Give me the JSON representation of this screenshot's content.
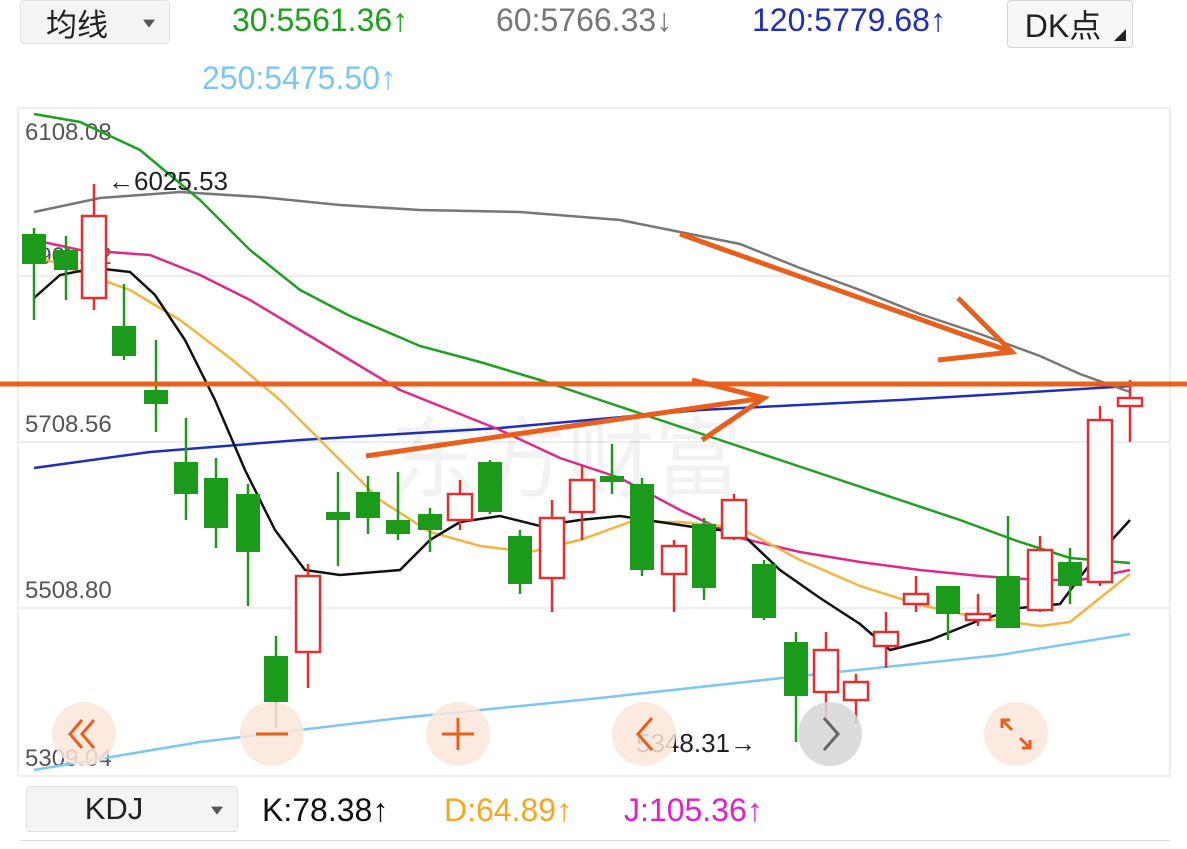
{
  "toolbar": {
    "indicator_select": "均线",
    "ma30": "30:5561.36",
    "ma60": "60:5766.33",
    "ma120": "120:5779.68",
    "ma250": "250:5475.50",
    "ma30_arrow": "↑",
    "ma60_arrow": "↓",
    "ma120_arrow": "↑",
    "ma250_arrow": "↑",
    "dk_button": "DK点"
  },
  "colors": {
    "ma5": "#111111",
    "ma10": "#f5b342",
    "ma20": "#e0288c",
    "ma30": "#1ea01e",
    "ma60": "#777777",
    "ma120": "#1f2fb8",
    "ma250": "#7cc7f2",
    "up": "#e03030",
    "down": "#1c9a1c",
    "annotation": "#e8601c"
  },
  "chart": {
    "y_labels": [
      "6108.08",
      "5908.32",
      "5708.56",
      "5508.80",
      "5309.04"
    ],
    "high_marker": "←6025.53",
    "low_marker": "5348.31→",
    "watermark": "东方财富"
  },
  "nav_icons": [
    "rewind-icon",
    "minus-icon",
    "plus-icon",
    "prev-icon",
    "next-icon",
    "expand-icon"
  ],
  "kdj": {
    "select": "KDJ",
    "k": "K:78.38",
    "d": "D:64.89",
    "j": "J:105.36",
    "k_arrow": "↑",
    "d_arrow": "↑",
    "j_arrow": "↑"
  }
}
